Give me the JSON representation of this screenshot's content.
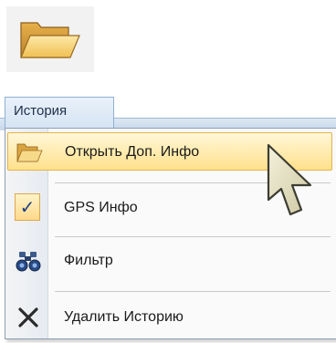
{
  "menu": {
    "tab_label": "История",
    "items": [
      {
        "label": "Открыть Доп. Инфо",
        "icon": "folder-open-icon",
        "highlighted": true
      },
      {
        "label": "GPS Инфо",
        "icon": "checkmark-icon",
        "checked": true
      },
      {
        "label": "Фильтр",
        "icon": "binoculars-icon"
      },
      {
        "label": "Удалить Историю",
        "icon": "delete-x-icon"
      }
    ],
    "check_glyph": "✓"
  },
  "colors": {
    "highlight": "#ffe18b",
    "folder": "#f0c35a",
    "menu_tab": "#d6e4f3"
  }
}
